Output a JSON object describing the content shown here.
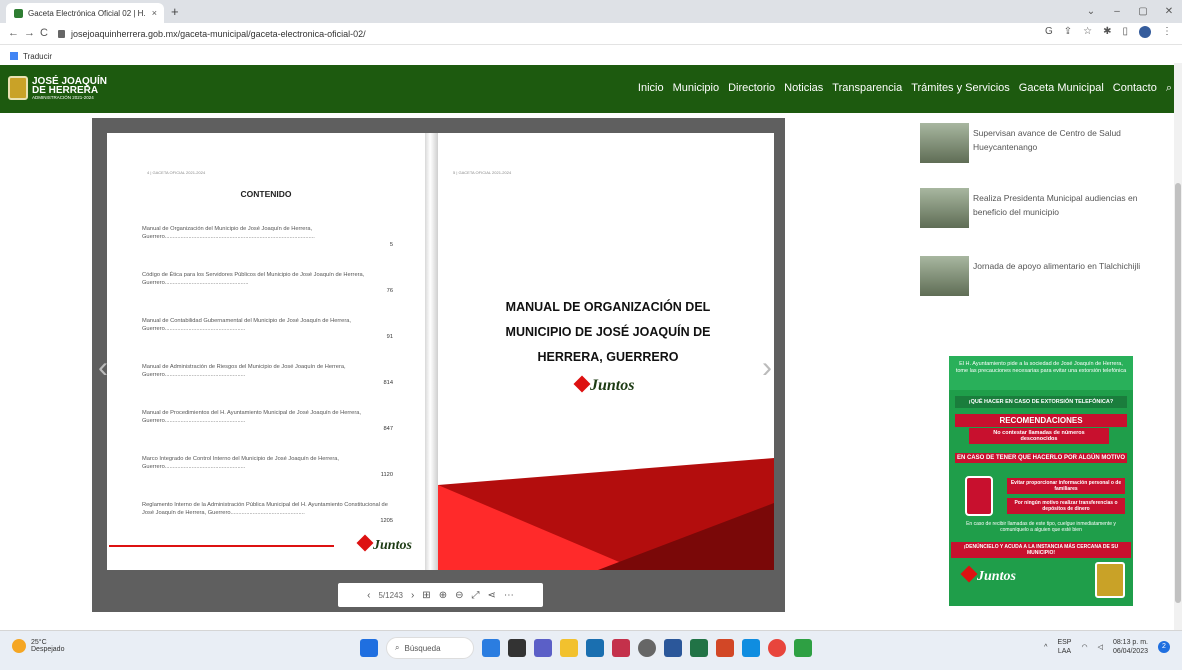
{
  "browser": {
    "tab_title": "Gaceta Electrónica Oficial 02 | H.",
    "tab_close": "×",
    "new_tab": "+",
    "url": "josejoaquinherrera.gob.mx/gaceta-municipal/gaceta-electronica-oficial-02/",
    "bookmark": "Traducir",
    "back": "←",
    "forward": "→",
    "reload": "C"
  },
  "site": {
    "logo_line1": "JOSÉ JOAQUÍN",
    "logo_line2": "DE HERRERA",
    "logo_line3": "ADMINISTRACIÓN 2021-2024",
    "menu": [
      "Inicio",
      "Municipio",
      "Directorio",
      "Noticias",
      "Transparencia",
      "Trámites y Servicios",
      "Gaceta Municipal",
      "Contacto"
    ]
  },
  "viewer": {
    "left_page_header": "4 | GACETA OFICIAL 2021-2024",
    "right_page_header": "5 | GACETA OFICIAL 2021-2024",
    "contents_title": "CONTENIDO",
    "toc": [
      {
        "text": "Manual de Organización del Municipio de José Joaquín de Herrera, Guerrero...............................................................................................",
        "page": "5"
      },
      {
        "text": "Código de Ética para los Servidores Públicos del Municipio de José Joaquín de Herrera, Guerrero.....................................................",
        "page": "76"
      },
      {
        "text": "Manual de Contabilidad Gubernamental del Municipio de José Joaquín de Herrera, Guerrero...................................................",
        "page": "91"
      },
      {
        "text": "Manual de Administración de Riesgos del Municipio de José Joaquín de Herrera, Guerrero...................................................",
        "page": "814"
      },
      {
        "text": "Manual de Procedimientos del H. Ayuntamiento Municipal de José Joaquín de Herrera, Guerrero...................................................",
        "page": "847"
      },
      {
        "text": "Marco Integrado de Control Interno del Municipio de José Joaquín de Herrera, Guerrero...................................................",
        "page": "1120"
      },
      {
        "text": "Reglamento Interno de la Administración Pública Municipal del H. Ayuntamiento Constitucional de José Joaquín de Herrera, Guerrero...............................................",
        "page": "1205"
      }
    ],
    "right_title_l1": "MANUAL DE ORGANIZACIÓN DEL",
    "right_title_l2": "MUNICIPIO DE JOSÉ JOAQUÍN DE",
    "right_title_l3": "HERRERA, GUERRERO",
    "juntos": "Juntos",
    "page_indicator": "5/1243"
  },
  "sidebar": {
    "news": [
      "Supervisan avance de Centro de Salud Hueycantenango",
      "Realiza Presidenta Municipal audiencias en beneficio del municipio",
      "Jornada de apoyo alimentario en Tlalchichijli"
    ],
    "ad": {
      "header": "El H. Ayuntamiento pide a la sociedad de José Joaquín de Herrera, tome las precauciones necesarias para evitar una extorsión telefónica",
      "what_to_do": "¡QUÉ HACER EN CASO DE EXTORSIÓN TELEFÓNICA?",
      "recomendaciones": "RECOMENDACIONES",
      "no_contestar": "No contestar llamadas de números desconocidos",
      "en_caso": "EN CASO DE TENER QUE HACERLO POR ALGÚN MOTIVO",
      "evitar": "Evitar proporcionar información personal o de familiares",
      "ningun": "Por ningún motivo realizar transferencias o depósitos de dinero",
      "si_recibe": "En caso de recibir llamadas de este tipo, cuelgue inmediatamente y comuníquelo a alguien que esté bien",
      "acuda": "¡DENÚNCIELO Y ACUDA A LA INSTANCIA MÁS CERCANA DE SU MUNICIPIO!",
      "juntos": "Juntos"
    }
  },
  "taskbar": {
    "temp": "25°C",
    "weather": "Despejado",
    "search": "Búsqueda",
    "lang1": "ESP",
    "lang2": "LAA",
    "time": "08:13 p. m.",
    "date": "06/04/2023",
    "notif": "2"
  }
}
